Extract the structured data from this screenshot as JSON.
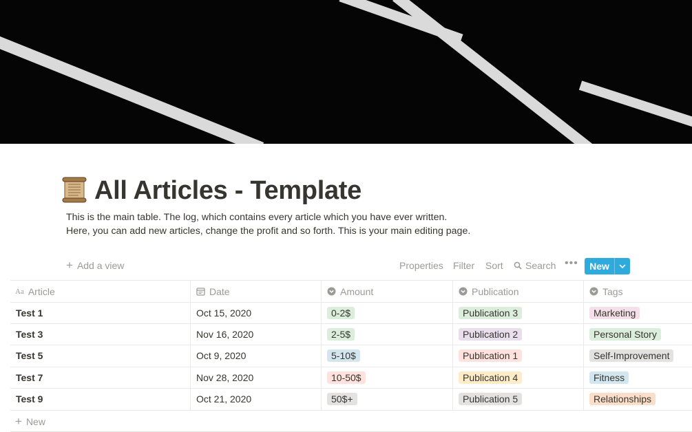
{
  "page": {
    "title": "All Articles - Template",
    "icon": "scroll-icon",
    "description": [
      "This is the main table. The log, which contains every article which you have ever written.",
      "Here, you can add new articles, change the profit and so forth. This is your main editing page."
    ]
  },
  "toolbar": {
    "add_view": "Add a view",
    "properties": "Properties",
    "filter": "Filter",
    "sort": "Sort",
    "search": "Search",
    "more": "•••",
    "new": "New"
  },
  "table": {
    "columns": [
      {
        "label": "Article",
        "icon": "text-icon"
      },
      {
        "label": "Date",
        "icon": "calendar-icon"
      },
      {
        "label": "Amount",
        "icon": "select-icon"
      },
      {
        "label": "Publication",
        "icon": "select-icon"
      },
      {
        "label": "Tags",
        "icon": "select-icon"
      }
    ],
    "rows": [
      {
        "article": "Test 1",
        "date": "Oct 15, 2020",
        "amount": "0-2$",
        "amount_color": "#dbeddb",
        "publication": "Publication 3",
        "publication_color": "#dbeddb",
        "tag": "Marketing",
        "tag_color": "#f5e0e9"
      },
      {
        "article": "Test 3",
        "date": "Nov 16, 2020",
        "amount": "2-5$",
        "amount_color": "#dbeddb",
        "publication": "Publication 2",
        "publication_color": "#e8deee",
        "tag": "Personal Story",
        "tag_color": "#dbeddb"
      },
      {
        "article": "Test 5",
        "date": "Oct 9, 2020",
        "amount": "5-10$",
        "amount_color": "#d3e5ef",
        "publication": "Publication 1",
        "publication_color": "#ffe2dd",
        "tag": "Self-Improvement",
        "tag_color": "#e3e2e0"
      },
      {
        "article": "Test 7",
        "date": "Nov 28, 2020",
        "amount": "10-50$",
        "amount_color": "#ffe2dd",
        "publication": "Publication 4",
        "publication_color": "#fdecc8",
        "tag": "Fitness",
        "tag_color": "#d3e5ef"
      },
      {
        "article": "Test 9",
        "date": "Oct 21, 2020",
        "amount": "50$+",
        "amount_color": "#e3e2e0",
        "publication": "Publication 5",
        "publication_color": "#e3e2e0",
        "tag": "Relationships",
        "tag_color": "#fadec9"
      }
    ],
    "new_row": "New"
  },
  "colors": {
    "accent": "#2eaadc",
    "text": "#37352f",
    "muted": "#9b9a97",
    "border": "#e9e9e7"
  }
}
